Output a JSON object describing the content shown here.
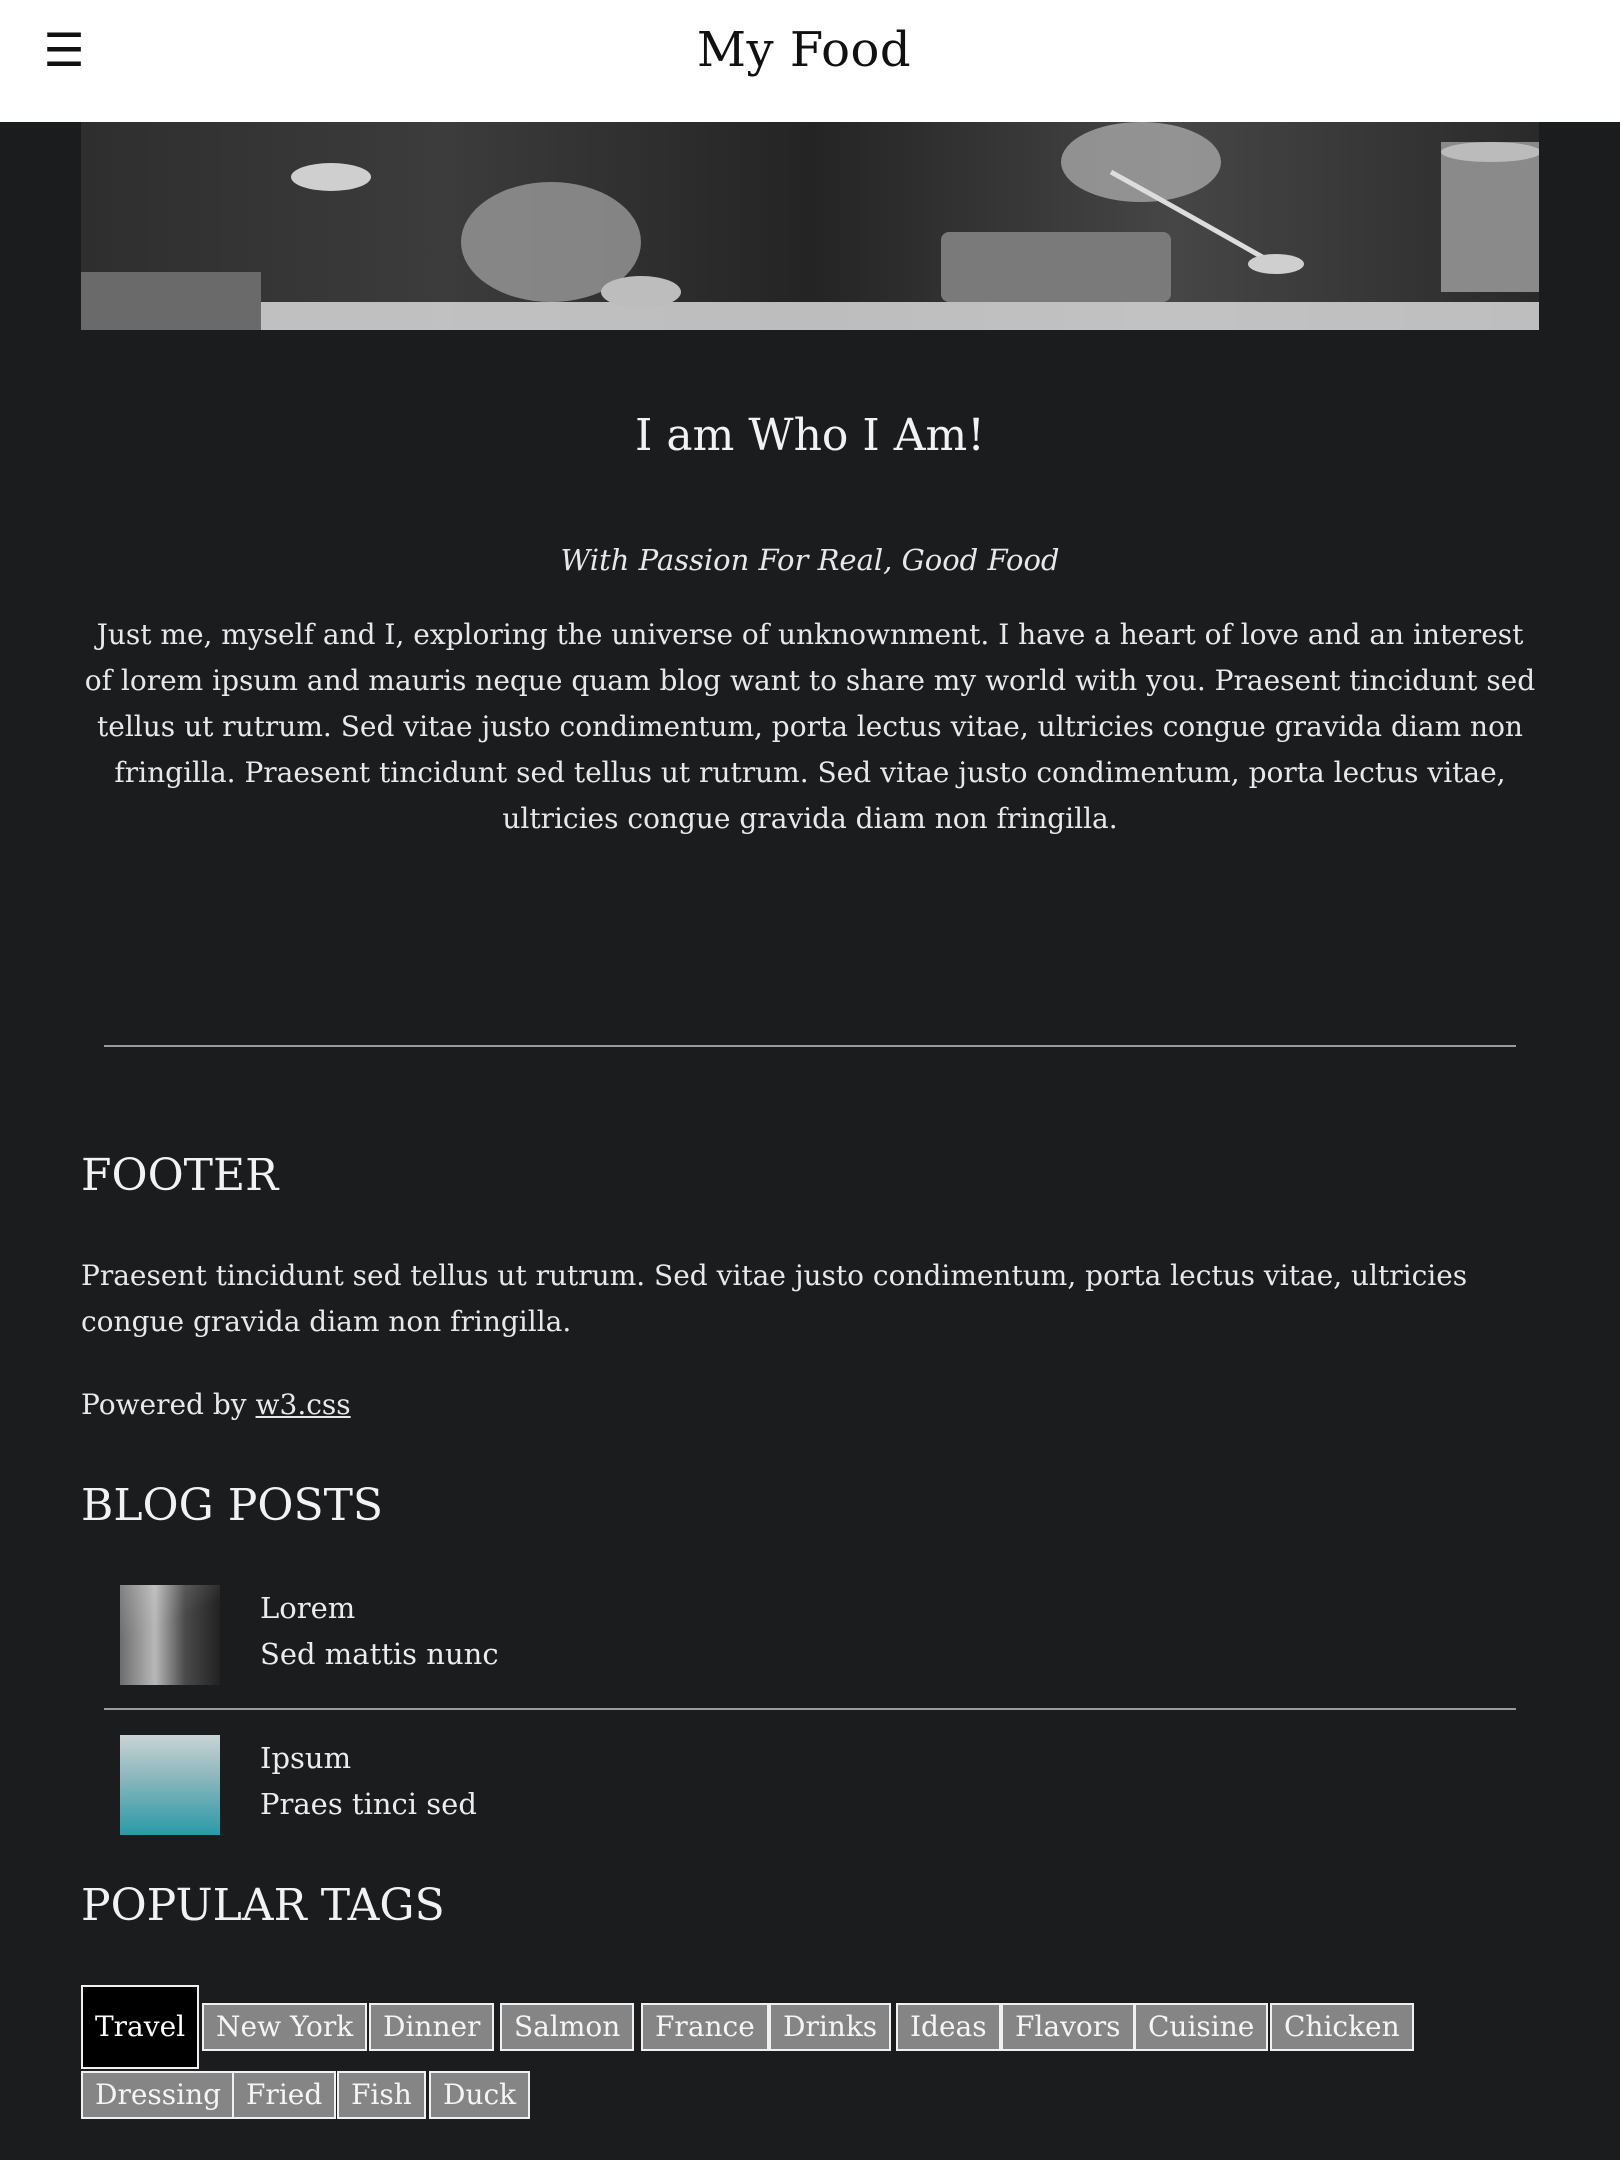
{
  "header": {
    "menu_icon": "☰",
    "title": "My Food"
  },
  "about": {
    "title": "I am Who I Am!",
    "subtitle": "With Passion For Real, Good Food",
    "body": "Just me, myself and I, exploring the universe of unknownment. I have a heart of love and an interest of lorem ipsum and mauris neque quam blog want to share my world with you. Praesent tincidunt sed tellus ut rutrum. Sed vitae justo condimentum, porta lectus vitae, ultricies congue gravida diam non fringilla. Praesent tincidunt sed tellus ut rutrum. Sed vitae justo condimentum, porta lectus vitae, ultricies congue gravida diam non fringilla."
  },
  "footer": {
    "title": "FOOTER",
    "text": "Praesent tincidunt sed tellus ut rutrum. Sed vitae justo condimentum, porta lectus vitae, ultricies congue gravida diam non fringilla.",
    "powered_prefix": "Powered by ",
    "powered_link": "w3.css"
  },
  "blog": {
    "title": "BLOG POSTS",
    "posts": [
      {
        "name": "Lorem",
        "desc": "Sed mattis nunc"
      },
      {
        "name": "Ipsum",
        "desc": "Praes tinci sed"
      }
    ]
  },
  "tags": {
    "title": "POPULAR TAGS",
    "active": "Travel",
    "items": [
      "Travel",
      "New York",
      "Dinner",
      "Salmon",
      "France",
      "Drinks",
      "Ideas",
      "Flavors",
      "Cuisine",
      "Chicken",
      "Dressing",
      "Fried",
      "Fish",
      "Duck"
    ]
  },
  "colors": {
    "page_background": "#1b1c1e",
    "topbar_background": "#ffffff",
    "tag_background": "#858585",
    "tag_active_background": "#000000"
  }
}
